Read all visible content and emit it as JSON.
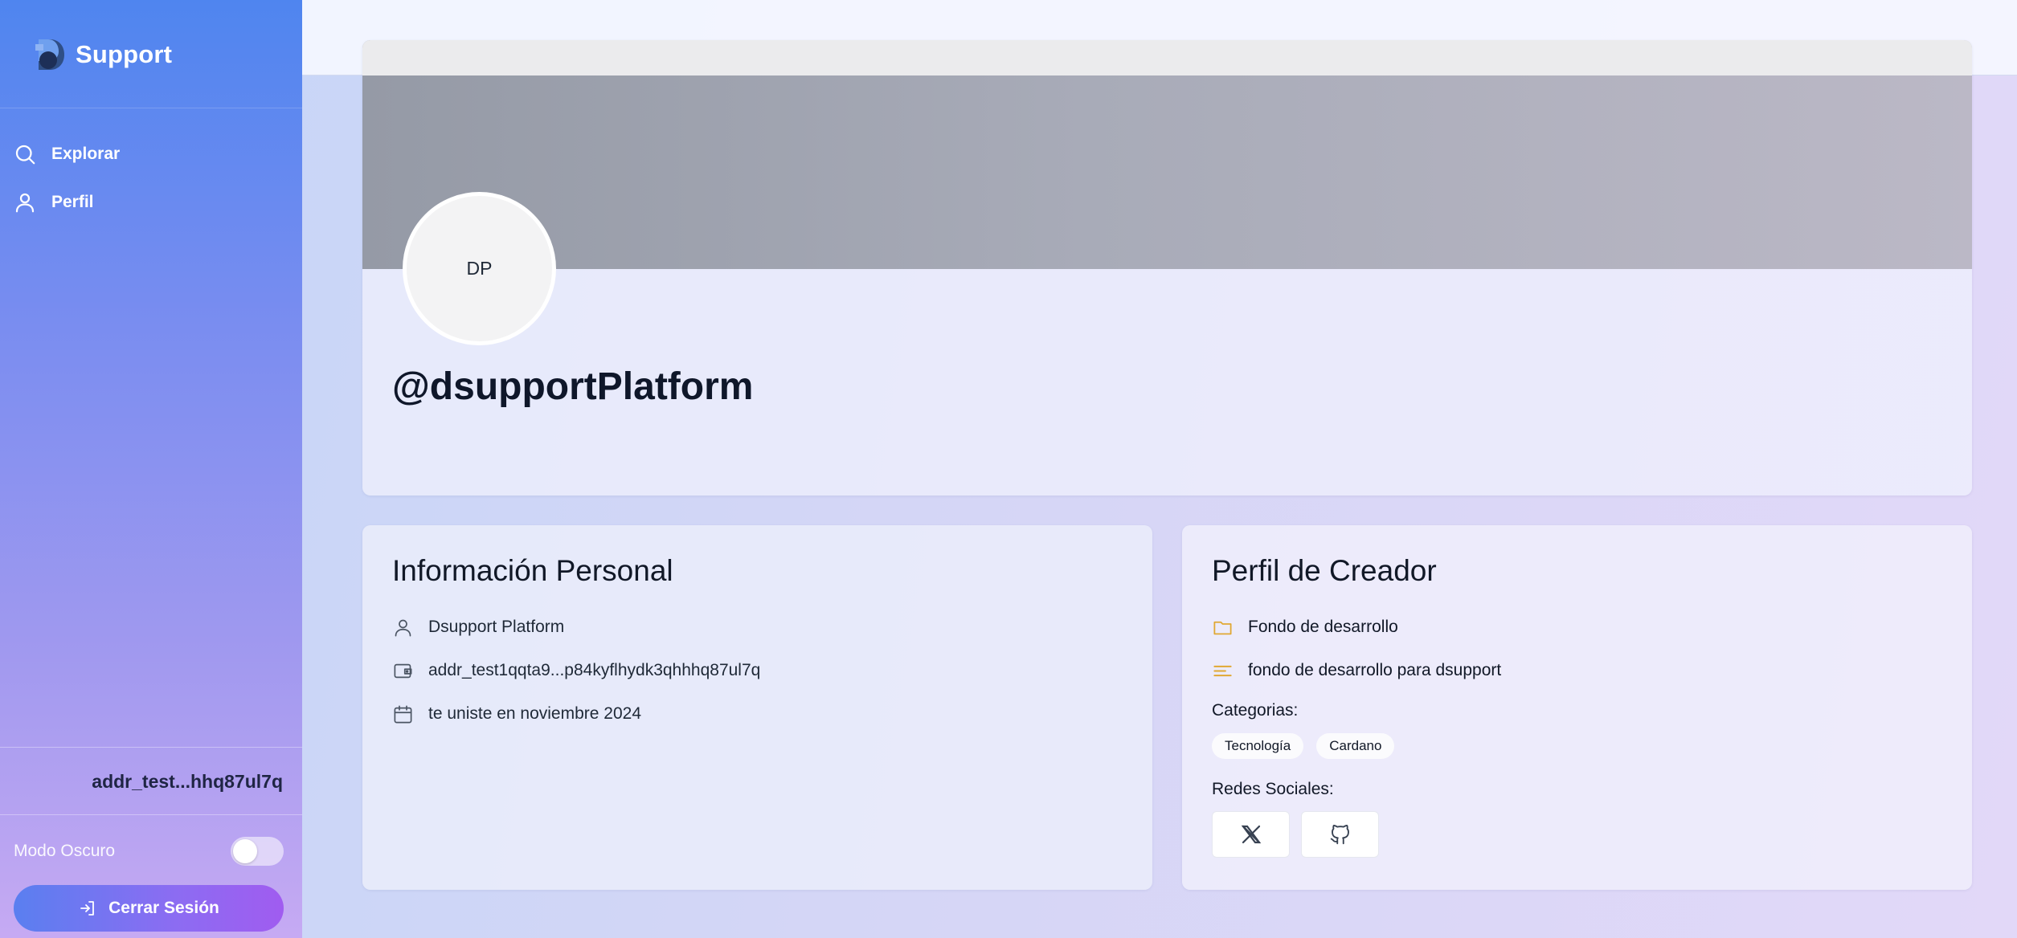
{
  "sidebar": {
    "brand": "Support",
    "nav": [
      {
        "label": "Explorar",
        "icon": "search-icon"
      },
      {
        "label": "Perfil",
        "icon": "user-icon"
      }
    ],
    "address": "addr_test...hhq87ul7q",
    "dark_mode_label": "Modo Oscuro",
    "dark_mode_on": false,
    "logout_label": "Cerrar Sesión"
  },
  "profile": {
    "avatar_initials": "DP",
    "username": "@dsupportPlatform"
  },
  "personal": {
    "title": "Información Personal",
    "name": "Dsupport Platform",
    "wallet": "addr_test1qqta9...p84kyflhydk3qhhhq87ul7q",
    "joined": "te uniste en noviembre 2024"
  },
  "creator": {
    "title": "Perfil de Creador",
    "project": "Fondo de desarrollo",
    "description": "fondo de desarrollo para dsupport",
    "categories_label": "Categorias:",
    "categories": [
      "Tecnología",
      "Cardano"
    ],
    "social_label": "Redes Sociales:",
    "socials": [
      "x-icon",
      "github-icon"
    ]
  },
  "colors": {
    "accent": "#5a7ff0",
    "accent_end": "#a05cf0",
    "folder_icon": "#e0a833"
  }
}
